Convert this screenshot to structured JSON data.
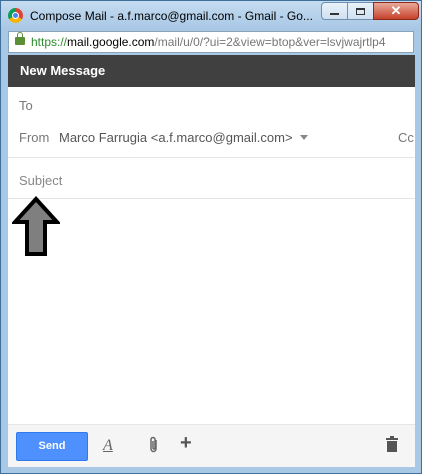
{
  "window": {
    "title": "Compose Mail - a.f.marco@gmail.com - Gmail - Go...",
    "close_label": "✕"
  },
  "address_bar": {
    "protocol": "https://",
    "host": "mail.google.com",
    "path": "/mail/u/0/?ui=2&view=btop&ver=lsvjwajrtlp4"
  },
  "compose": {
    "header_title": "New Message",
    "to_label": "To",
    "from_label": "From",
    "from_value": "Marco Farrugia <a.f.marco@gmail.com>",
    "cc_label": "Cc",
    "subject_placeholder": "Subject",
    "body_value": ""
  },
  "footer": {
    "send_label": "Send",
    "format_label": "A",
    "more_label": "+"
  },
  "annotation": {
    "arrow_color": "#7f7f7f"
  }
}
